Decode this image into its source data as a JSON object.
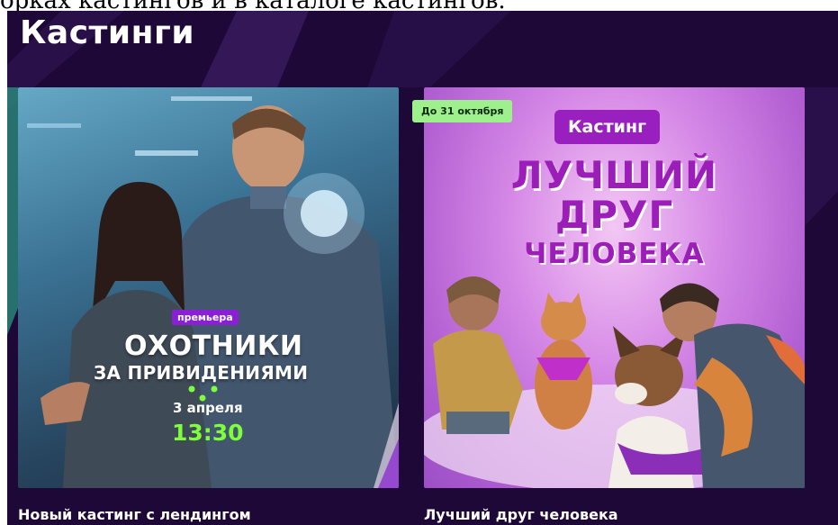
{
  "top_caption": "орках кастингов и в каталоге кастингов.",
  "section": {
    "title": "Кастинги"
  },
  "cards": [
    {
      "title": "Новый кастинг с лендингом",
      "poster": {
        "badge": "премьера",
        "title_line1": "ОХОТНИКИ",
        "title_line2": "ЗА ПРИВИДЕНИЯМИ",
        "date": "3 апреля",
        "time": "13:30"
      }
    },
    {
      "title": "Лучший друг человека",
      "deadline": "До 31 октября",
      "poster": {
        "badge": "Кастинг",
        "title_line1": "ЛУЧШИЙ",
        "title_line2": "ДРУГ",
        "title_line3": "ЧЕЛОВЕКА"
      }
    }
  ]
}
